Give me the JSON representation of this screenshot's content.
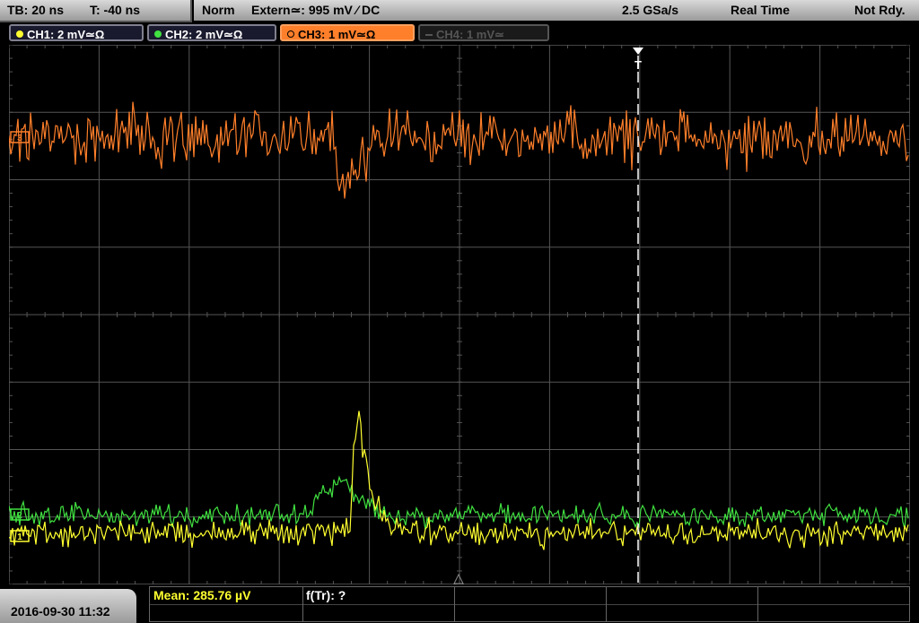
{
  "topbar": {
    "timebase": "TB: 20 ns",
    "trigger_pos": "T: -40 ns",
    "mode": "Norm",
    "trigger_source": "Extern≃: 995 mV ⁄ DC",
    "sample_rate": "2.5 GSa/s",
    "acq_mode": "Real Time",
    "status": "Not Rdy."
  },
  "channels": [
    {
      "label": "CH1: 2 mV≃Ω",
      "color": "#ffff30",
      "active": true
    },
    {
      "label": "CH2: 2 mV≃Ω",
      "color": "#40e040",
      "active": true
    },
    {
      "label": "CH3: 1 mV≃Ω",
      "color": "#ff7f2a",
      "active": true,
      "selected": true
    },
    {
      "label": "CH4: 1 mV≃",
      "color": "#555555",
      "active": false
    }
  ],
  "markers": {
    "ch3_marker": "3",
    "ch2_marker": "2",
    "ch1_marker": "1",
    "trigger_marker": "T"
  },
  "bottombar": {
    "datetime": "2016-09-30 11:32",
    "mean": "Mean: 285.76 µV",
    "freq": "f(Tr): ?"
  },
  "colors": {
    "grid": "#555555",
    "ch1": "#ffff30",
    "ch2": "#40e040",
    "ch3": "#ff7f2a"
  }
}
